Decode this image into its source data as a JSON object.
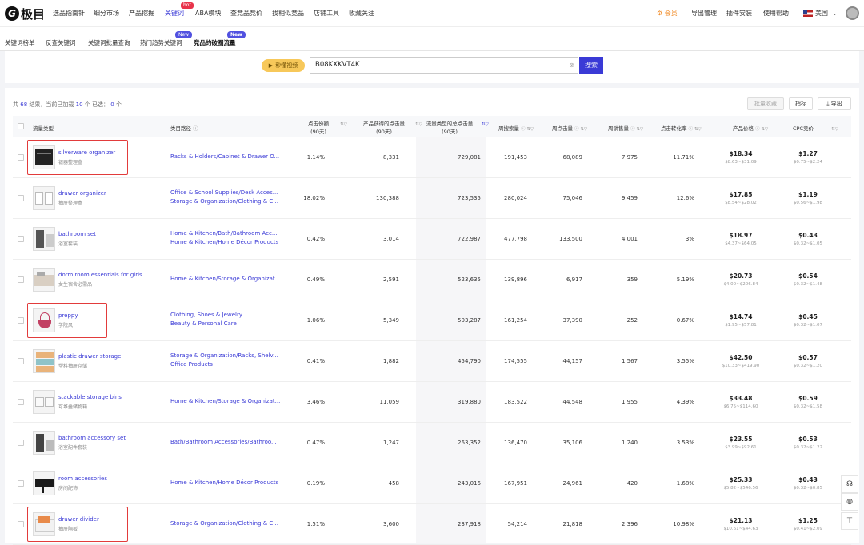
{
  "brand": {
    "logo_glyph": "G",
    "name": "极目"
  },
  "topnav": {
    "items": [
      "选品指南针",
      "细分市场",
      "产品挖掘",
      "关键词",
      "ABA模块",
      "查竞品竞价",
      "找相似竞品",
      "店铺工具",
      "收藏关注"
    ],
    "active_index": 3,
    "hot_label": "hot",
    "right": [
      "会员",
      "导出管理",
      "插件安装",
      "使用帮助"
    ],
    "country": "美国"
  },
  "subnav": {
    "items": [
      "关键词榜单",
      "反查关键词",
      "关键词批量查询",
      "热门趋势关键词",
      "竞品的破圈流量"
    ],
    "new_label": "New",
    "active_index": 4
  },
  "search": {
    "video_label": "秒懂视频",
    "value": "B08KXKVT4K",
    "button": "搜索"
  },
  "summary": {
    "prefix": "共",
    "total": "68",
    "middle": "结果，当前已加载",
    "loaded": "10",
    "suffix": "个 已选：",
    "selected": "0",
    "unit": "个"
  },
  "toolbar": {
    "batch_collect": "批量收藏",
    "metrics": "指标",
    "export": "导出"
  },
  "columns": {
    "flow_type": "流量类型",
    "category_path": "类目路径",
    "click_share": [
      "点击份额",
      "(90天)"
    ],
    "product_clicks": [
      "产品获得的点击量",
      "(90天)"
    ],
    "total_clicks": [
      "流量类型的总点击量",
      "(90天)"
    ],
    "weekly_search": "周搜索量",
    "weekly_clicks": "周点击量",
    "weekly_sales": "周销售量",
    "ctr": "点击转化率",
    "price": "产品价格",
    "cpc": "CPC竞价"
  },
  "rows": [
    {
      "kw": "silverware organizer",
      "kw_cn": "银器整理盒",
      "cat": [
        "Racks & Holders/Cabinet & Drawer O..."
      ],
      "share": "1.14%",
      "pclicks": "8,331",
      "tclicks": "729,081",
      "wsearch": "191,453",
      "wclicks": "68,089",
      "wsales": "7,975",
      "ctr": "11.71%",
      "price": "$18.34",
      "prange": "$8.63~$31.09",
      "cpc": "$1.27",
      "crange": "$0.75~$2.24",
      "boxed": true
    },
    {
      "kw": "drawer organizer",
      "kw_cn": "抽屉整理盒",
      "cat": [
        "Office & School Supplies/Desk Acces...",
        "Storage & Organization/Clothing & C..."
      ],
      "share": "18.02%",
      "pclicks": "130,388",
      "tclicks": "723,535",
      "wsearch": "280,024",
      "wclicks": "75,046",
      "wsales": "9,459",
      "ctr": "12.6%",
      "price": "$17.85",
      "prange": "$8.54~$28.02",
      "cpc": "$1.19",
      "crange": "$0.56~$1.98",
      "boxed": false
    },
    {
      "kw": "bathroom set",
      "kw_cn": "浴室套装",
      "cat": [
        "Home & Kitchen/Bath/Bathroom Acc...",
        "Home & Kitchen/Home Décor Products"
      ],
      "share": "0.42%",
      "pclicks": "3,014",
      "tclicks": "722,987",
      "wsearch": "477,798",
      "wclicks": "133,500",
      "wsales": "4,001",
      "ctr": "3%",
      "price": "$18.97",
      "prange": "$4.37~$64.05",
      "cpc": "$0.43",
      "crange": "$0.32~$1.05",
      "boxed": false
    },
    {
      "kw": "dorm room essentials for girls",
      "kw_cn": "女生宿舍必需品",
      "cat": [
        "Home & Kitchen/Storage & Organizat..."
      ],
      "share": "0.49%",
      "pclicks": "2,591",
      "tclicks": "523,635",
      "wsearch": "139,896",
      "wclicks": "6,917",
      "wsales": "359",
      "ctr": "5.19%",
      "price": "$20.73",
      "prange": "$4.00~$206.84",
      "cpc": "$0.54",
      "crange": "$0.32~$1.48",
      "boxed": false
    },
    {
      "kw": "preppy",
      "kw_cn": "学院风",
      "cat": [
        "Clothing, Shoes & Jewelry",
        "Beauty & Personal Care"
      ],
      "share": "1.06%",
      "pclicks": "5,349",
      "tclicks": "503,287",
      "wsearch": "161,254",
      "wclicks": "37,390",
      "wsales": "252",
      "ctr": "0.67%",
      "price": "$14.74",
      "prange": "$1.95~$57.81",
      "cpc": "$0.45",
      "crange": "$0.32~$1.07",
      "boxed": true
    },
    {
      "kw": "plastic drawer storage",
      "kw_cn": "塑料抽屉存储",
      "cat": [
        "Storage & Organization/Racks, Shelv...",
        "Office Products"
      ],
      "share": "0.41%",
      "pclicks": "1,882",
      "tclicks": "454,790",
      "wsearch": "174,555",
      "wclicks": "44,157",
      "wsales": "1,567",
      "ctr": "3.55%",
      "price": "$42.50",
      "prange": "$10.33~$419.90",
      "cpc": "$0.57",
      "crange": "$0.32~$1.20",
      "boxed": false
    },
    {
      "kw": "stackable storage bins",
      "kw_cn": "可堆叠储物箱",
      "cat": [
        "Home & Kitchen/Storage & Organizat..."
      ],
      "share": "3.46%",
      "pclicks": "11,059",
      "tclicks": "319,880",
      "wsearch": "183,522",
      "wclicks": "44,548",
      "wsales": "1,955",
      "ctr": "4.39%",
      "price": "$33.48",
      "prange": "$6.75~$114.60",
      "cpc": "$0.59",
      "crange": "$0.32~$1.58",
      "boxed": false
    },
    {
      "kw": "bathroom accessory set",
      "kw_cn": "浴室配件套装",
      "cat": [
        "Bath/Bathroom Accessories/Bathroo..."
      ],
      "share": "0.47%",
      "pclicks": "1,247",
      "tclicks": "263,352",
      "wsearch": "136,470",
      "wclicks": "35,106",
      "wsales": "1,240",
      "ctr": "3.53%",
      "price": "$23.55",
      "prange": "$3.99~$92.61",
      "cpc": "$0.53",
      "crange": "$0.32~$1.22",
      "boxed": false
    },
    {
      "kw": "room accessories",
      "kw_cn": "房间配饰",
      "cat": [
        "Home & Kitchen/Home Décor Products"
      ],
      "share": "0.19%",
      "pclicks": "458",
      "tclicks": "243,016",
      "wsearch": "167,951",
      "wclicks": "24,961",
      "wsales": "420",
      "ctr": "1.68%",
      "price": "$25.33",
      "prange": "$5.82~$546.56",
      "cpc": "$0.43",
      "crange": "$0.32~$0.85",
      "boxed": false
    },
    {
      "kw": "drawer divider",
      "kw_cn": "抽屉隔板",
      "cat": [
        "Storage & Organization/Clothing & C..."
      ],
      "share": "1.51%",
      "pclicks": "3,600",
      "tclicks": "237,918",
      "wsearch": "54,214",
      "wclicks": "21,818",
      "wsales": "2,396",
      "ctr": "10.98%",
      "price": "$21.13",
      "prange": "$10.61~$44.63",
      "cpc": "$1.25",
      "crange": "$0.41~$2.09",
      "boxed": true
    }
  ],
  "colors": {
    "accent": "#3a3ad6",
    "highlight_box": "#e23b3b",
    "member": "#f08a24"
  },
  "side_icons": [
    "headset-icon",
    "globe-icon",
    "back-to-top-icon"
  ]
}
